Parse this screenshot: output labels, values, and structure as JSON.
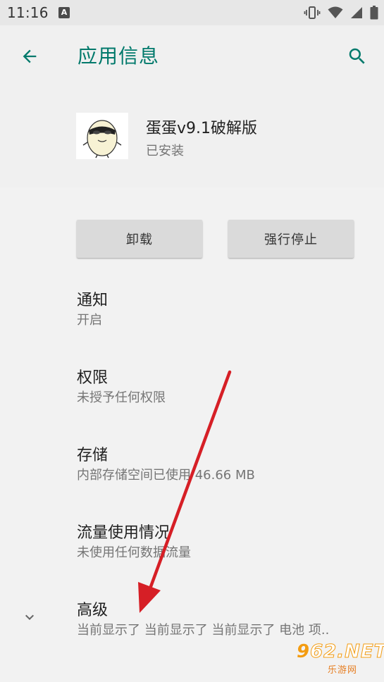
{
  "status_bar": {
    "time": "11:16",
    "badge": "A",
    "icons": [
      "vibrate-icon",
      "wifi-icon",
      "cellular-signal-icon",
      "battery-icon"
    ]
  },
  "app_bar": {
    "title": "应用信息",
    "accent_color": "#00796b",
    "back_icon": "arrow-back-icon",
    "search_icon": "search-icon"
  },
  "app": {
    "name": "蛋蛋v9.1破解版",
    "status": "已安装",
    "icon": "egg-character-icon"
  },
  "buttons": {
    "uninstall": "卸载",
    "force_stop": "强行停止"
  },
  "items": [
    {
      "title": "通知",
      "summary": "开启"
    },
    {
      "title": "权限",
      "summary": "未授予任何权限"
    },
    {
      "title": "存储",
      "summary": "内部存储空间已使用 46.66 MB"
    },
    {
      "title": "流量使用情况",
      "summary": "未使用任何数据流量"
    },
    {
      "title": "高级",
      "summary": "当前显示了 当前显示了 当前显示了 电池 项..",
      "icon": "chevron-down-icon"
    }
  ],
  "watermark": {
    "main_prefix": "9",
    "main_suffix": "62.NET",
    "sub": "乐游网"
  }
}
